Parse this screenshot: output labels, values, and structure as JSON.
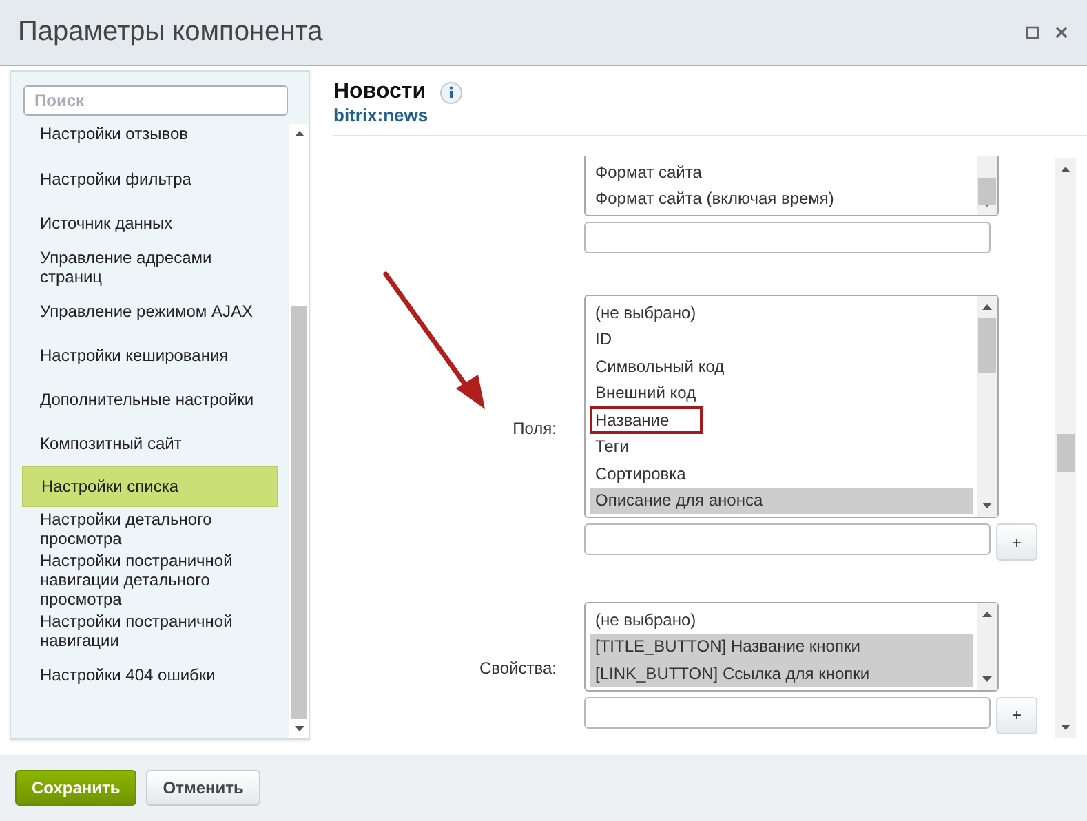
{
  "window": {
    "title": "Параметры компонента"
  },
  "sidebar": {
    "search": {
      "placeholder": "Поиск"
    },
    "items": [
      {
        "label": "Настройки отзывов",
        "selected": false
      },
      {
        "label": "Настройки фильтра",
        "selected": false
      },
      {
        "label": "Источник данных",
        "selected": false
      },
      {
        "label": "Управление адресами страниц",
        "selected": false
      },
      {
        "label": "Управление режимом AJAX",
        "selected": false
      },
      {
        "label": "Настройки кеширования",
        "selected": false
      },
      {
        "label": "Дополнительные настройки",
        "selected": false
      },
      {
        "label": "Композитный сайт",
        "selected": false
      },
      {
        "label": "Настройки списка",
        "selected": true
      },
      {
        "label": "Настройки детального просмотра",
        "selected": false
      },
      {
        "label": "Настройки постраничной навигации детального просмотра",
        "selected": false
      },
      {
        "label": "Настройки постраничной навигации",
        "selected": false
      },
      {
        "label": "Настройки 404 ошибки",
        "selected": false
      }
    ]
  },
  "component": {
    "title": "Новости",
    "code": "bitrix:news"
  },
  "fields": [
    {
      "options": [
        {
          "label": "Формат сайта",
          "selected": false,
          "outlined": false
        },
        {
          "label": "Формат сайта (включая время)",
          "selected": false,
          "outlined": false
        }
      ]
    },
    {
      "label": "Поля:",
      "options": [
        {
          "label": "(не выбрано)",
          "selected": false,
          "outlined": false
        },
        {
          "label": "ID",
          "selected": false,
          "outlined": false
        },
        {
          "label": "Символьный код",
          "selected": false,
          "outlined": false
        },
        {
          "label": "Внешний код",
          "selected": false,
          "outlined": false
        },
        {
          "label": "Название",
          "selected": false,
          "outlined": true
        },
        {
          "label": "Теги",
          "selected": false,
          "outlined": false
        },
        {
          "label": "Сортировка",
          "selected": false,
          "outlined": false
        },
        {
          "label": "Описание для анонса",
          "selected": true,
          "outlined": false
        }
      ],
      "add_label": "+"
    },
    {
      "label": "Свойства:",
      "options": [
        {
          "label": "(не выбрано)",
          "selected": false,
          "outlined": false
        },
        {
          "label": "[TITLE_BUTTON] Название кнопки",
          "selected": true,
          "outlined": false
        },
        {
          "label": "[LINK_BUTTON] Ссылка для кнопки",
          "selected": true,
          "outlined": false
        }
      ],
      "add_label": "+"
    }
  ],
  "buttons": [
    {
      "label": "Сохранить",
      "kind": "primary"
    },
    {
      "label": "Отменить",
      "kind": "secondary"
    }
  ]
}
